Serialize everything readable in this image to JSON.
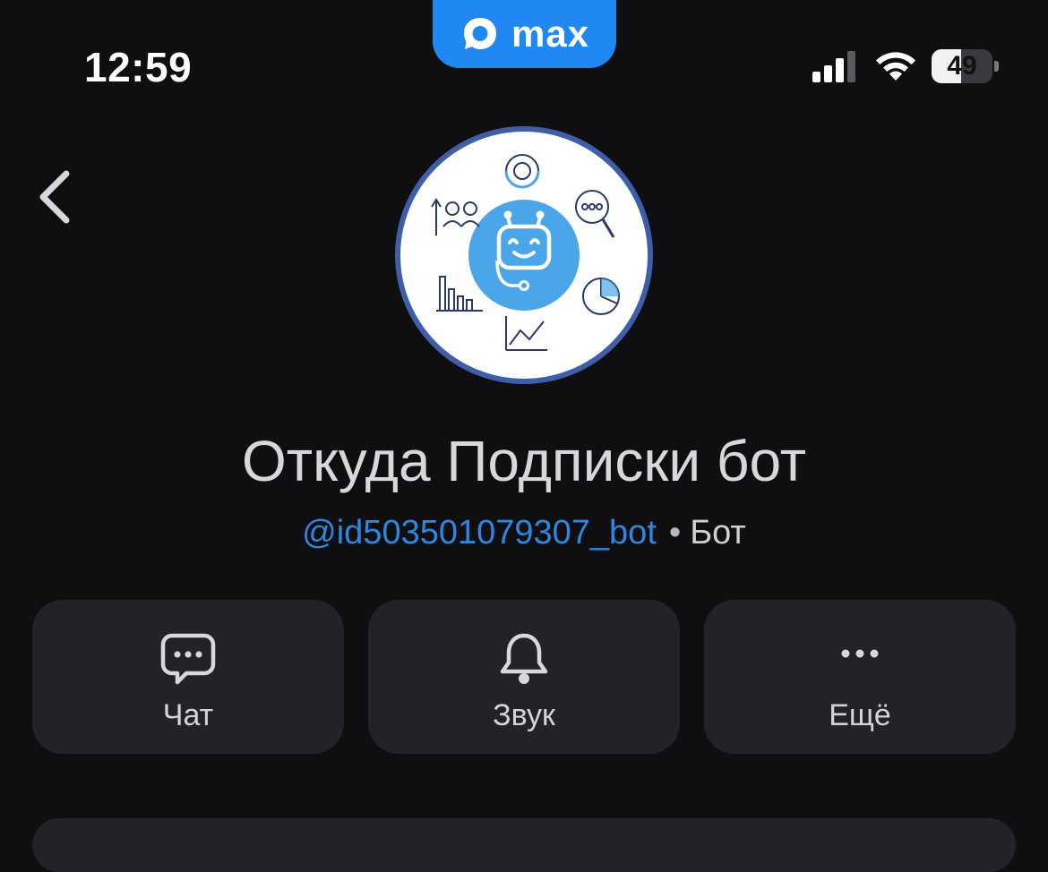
{
  "status_bar": {
    "time": "12:59",
    "app_badge": "max",
    "battery_percent": "49",
    "battery_level": 0.49,
    "signal_icon": "cellular-signal-icon",
    "wifi_icon": "wifi-icon"
  },
  "nav": {
    "back_icon": "chevron-left-icon"
  },
  "profile": {
    "name": "Откуда Подписки бот",
    "username": "@id503501079307_bot",
    "separator": "•",
    "type": "Бот"
  },
  "actions": [
    {
      "label": "Чат",
      "icon": "chat-bubble-icon"
    },
    {
      "label": "Звук",
      "icon": "bell-icon"
    },
    {
      "label": "Ещё",
      "icon": "more-dots-icon"
    }
  ],
  "colors": {
    "accent": "#1f88f2",
    "link": "#2f86e0",
    "background": "#0f0f12",
    "card": "#232327"
  }
}
